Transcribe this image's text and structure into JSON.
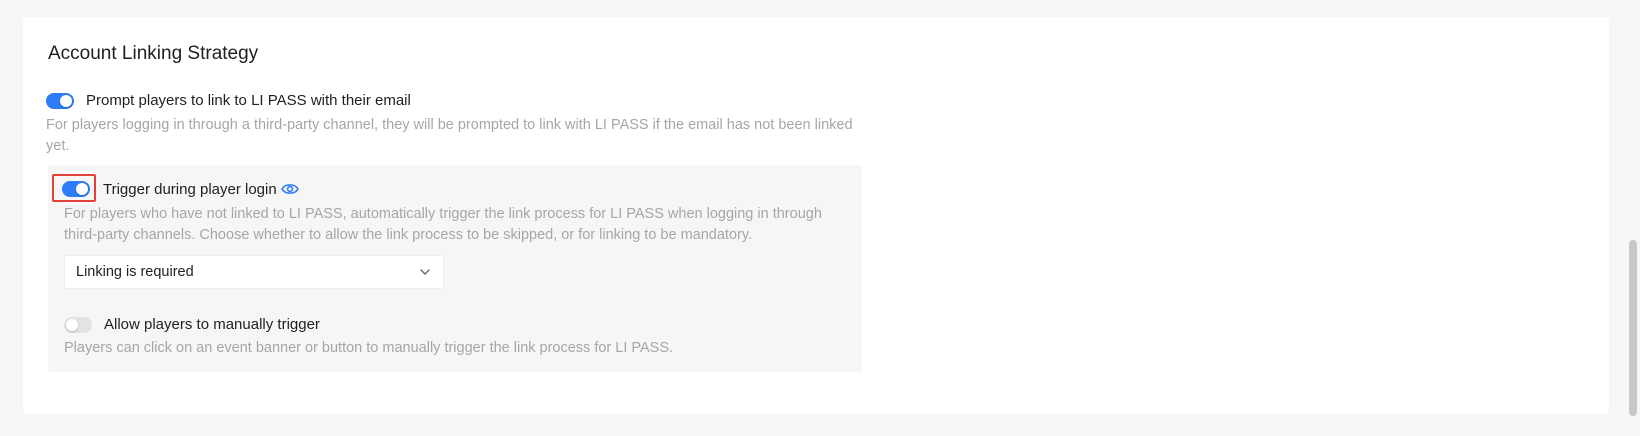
{
  "section": {
    "title": "Account Linking Strategy"
  },
  "prompt_link": {
    "enabled": true,
    "label": "Prompt players to link to LI PASS with their email",
    "description": "For players logging in through a third-party channel, they will be prompted to link with LI PASS if the email has not been linked yet."
  },
  "trigger_login": {
    "enabled": true,
    "label": "Trigger during player login",
    "description": "For players who have not linked to LI PASS, automatically trigger the link process for LI PASS when logging in through third-party channels. Choose whether to allow the link process to be skipped, or for linking to be mandatory.",
    "select_value": "Linking is required"
  },
  "manual_trigger": {
    "enabled": false,
    "label": "Allow players to manually trigger",
    "description": "Players can click on an event banner or button to manually trigger the link process for LI PASS."
  },
  "colors": {
    "accent": "#2e7cf6",
    "highlight": "#e24038",
    "muted_text": "#a6a6a6",
    "panel_bg": "#f6f6f6"
  },
  "icons": {
    "eye": "eye-icon",
    "dropdown": "chevron-down-icon"
  }
}
